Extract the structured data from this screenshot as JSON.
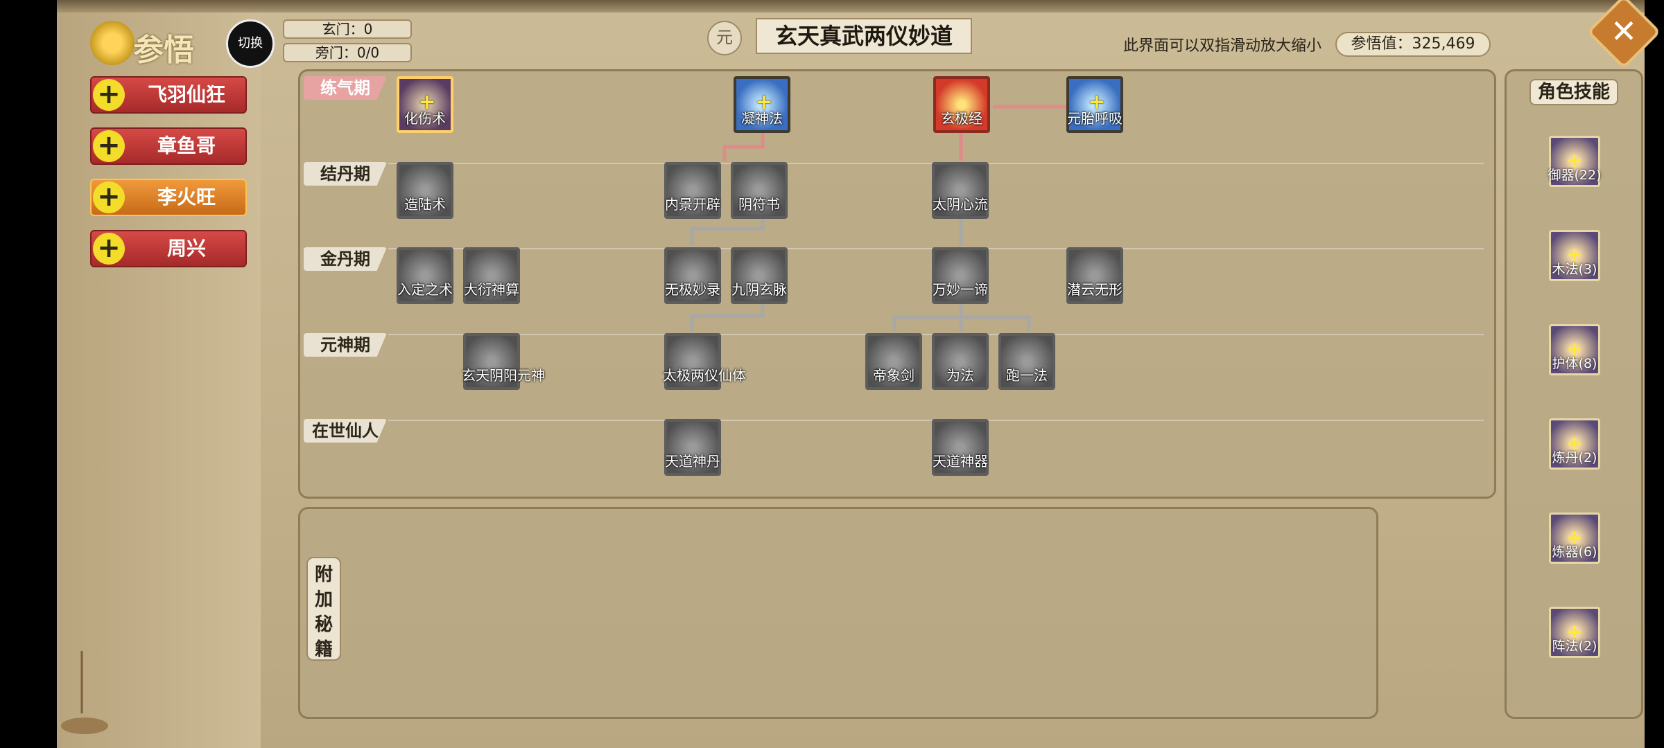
{
  "app": {
    "title": "参悟",
    "switch_label": "切换"
  },
  "counters": {
    "xuanmen": "玄门：0",
    "pangmen": "旁门：0/0"
  },
  "header": {
    "badge": "元",
    "title": "玄天真武两仪妙道",
    "hint": "此界面可以双指滑动放大缩小",
    "stat": "参悟值：325,469",
    "close": "✕"
  },
  "characters": [
    {
      "name": "飞羽仙狂",
      "active": false
    },
    {
      "name": "章鱼哥",
      "active": false
    },
    {
      "name": "李火旺",
      "active": true
    },
    {
      "name": "周兴",
      "active": false
    }
  ],
  "realms": [
    "练气期",
    "结丹期",
    "金丹期",
    "元神期",
    "在世仙人"
  ],
  "tree_nodes": [
    {
      "name": "化伤术",
      "state": "active-purple",
      "plus": true
    },
    {
      "name": "凝神法",
      "state": "active-blue",
      "plus": true
    },
    {
      "name": "玄极经",
      "state": "active-red"
    },
    {
      "name": "元胎呼吸",
      "state": "active-blue",
      "plus": true
    },
    {
      "name": "造陆术",
      "state": "locked"
    },
    {
      "name": "内景开辟",
      "state": "locked"
    },
    {
      "name": "阴符书",
      "state": "locked"
    },
    {
      "name": "太阴心流",
      "state": "locked"
    },
    {
      "name": "入定之术",
      "state": "locked"
    },
    {
      "name": "大衍神算",
      "state": "locked"
    },
    {
      "name": "无极妙录",
      "state": "locked"
    },
    {
      "name": "九阴玄脉",
      "state": "locked"
    },
    {
      "name": "万妙一谛",
      "state": "locked"
    },
    {
      "name": "潜云无形",
      "state": "locked"
    },
    {
      "name": "玄天阴阳元神",
      "state": "locked"
    },
    {
      "name": "太极两仪仙体",
      "state": "locked"
    },
    {
      "name": "帝象剑",
      "state": "locked"
    },
    {
      "name": "为法",
      "state": "locked"
    },
    {
      "name": "跑一法",
      "state": "locked"
    },
    {
      "name": "天道神丹",
      "state": "locked"
    },
    {
      "name": "天道神器",
      "state": "locked"
    }
  ],
  "side_panel": {
    "title": "角色技能",
    "skills": [
      "御器(22)",
      "木法(3)",
      "护体(8)",
      "炼丹(2)",
      "炼器(6)",
      "阵法(2)"
    ]
  },
  "extra": {
    "title": "附\n加\n秘\n籍"
  }
}
